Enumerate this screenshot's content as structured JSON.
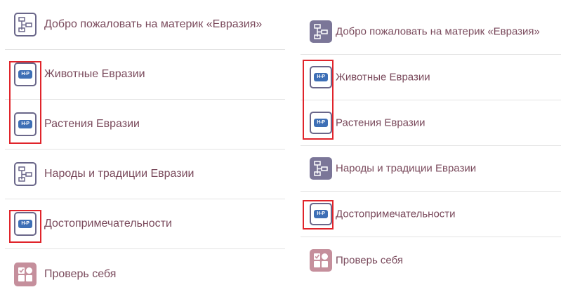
{
  "left_list": [
    {
      "label": "Добро пожаловать на материк «Евразия»",
      "icon": "flowchart-icon"
    },
    {
      "label": "Животные Евразии",
      "icon": "np-icon"
    },
    {
      "label": "Растения Евразии",
      "icon": "np-icon"
    },
    {
      "label": "Народы и традиции Евразии",
      "icon": "flowchart-icon"
    },
    {
      "label": "Достопримечательности",
      "icon": "np-icon"
    },
    {
      "label": "Проверь себя",
      "icon": "quiz-icon"
    }
  ],
  "right_list": [
    {
      "label": "Добро пожаловать на материк «Евразия»",
      "icon": "flowchart-filled-icon"
    },
    {
      "label": "Животные Евразии",
      "icon": "np-icon"
    },
    {
      "label": "Растения Евразии",
      "icon": "np-icon"
    },
    {
      "label": "Народы и традиции Евразии",
      "icon": "flowchart-filled-icon"
    },
    {
      "label": "Достопримечательности",
      "icon": "np-icon"
    },
    {
      "label": "Проверь себя",
      "icon": "quiz-icon"
    }
  ],
  "np_tag": "Н-Р",
  "colors": {
    "label_text": "#7a4a5c",
    "icon_border": "#6a678a",
    "icon_filled": "#7b7698",
    "np_tag": "#3e6fb6",
    "quiz_tile": "#c58f9c",
    "highlight": "#e0242b"
  }
}
